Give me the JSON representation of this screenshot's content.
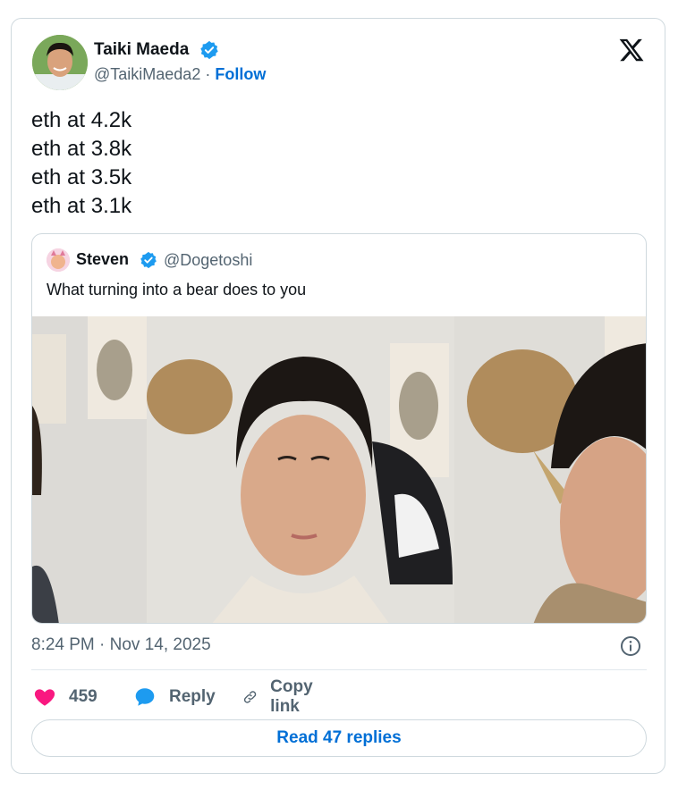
{
  "author": {
    "name": "Taiki Maeda",
    "handle": "@TaikiMaeda2",
    "separator": "·",
    "follow_label": "Follow"
  },
  "tweet": {
    "lines": [
      "eth at 4.2k",
      "eth at 3.8k",
      "eth at 3.5k",
      "eth at 3.1k"
    ]
  },
  "quote": {
    "name": "Steven",
    "handle": "@Dogetoshi",
    "text": "What turning into a bear does to you"
  },
  "timestamp": "8:24 PM · Nov 14, 2025",
  "actions": {
    "likes": "459",
    "reply_label": "Reply",
    "copy_label": "Copy link"
  },
  "read_replies_label": "Read 47 replies",
  "icons": {
    "verified": "verified-badge-icon",
    "brand": "x-logo-icon",
    "info": "info-icon",
    "like": "heart-icon",
    "reply": "reply-bubble-icon",
    "copy": "link-icon"
  },
  "colors": {
    "link": "#006fd6",
    "verified": "#1d9bf0",
    "heart": "#f91880",
    "muted": "#536471",
    "border": "#cfd9de"
  }
}
